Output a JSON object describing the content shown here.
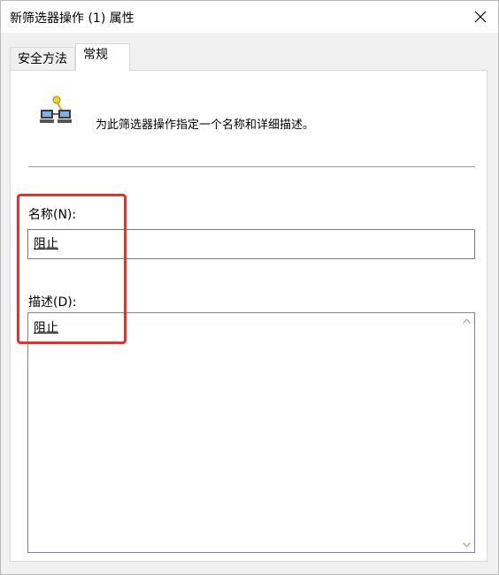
{
  "window": {
    "title": "新筛选器操作 (1) 属性"
  },
  "tabs": [
    {
      "label": "安全方法"
    },
    {
      "label": "常规"
    }
  ],
  "general": {
    "description_text": "为此筛选器操作指定一个名称和详细描述。",
    "name_label": "名称(N):",
    "name_value": "阻止",
    "desc_label": "描述(D):",
    "desc_value": "阻止"
  },
  "icons": {
    "close": "close-icon",
    "filter": "filter-action-icon",
    "scroll_up": "chevron-up-icon",
    "scroll_down": "chevron-down-icon"
  },
  "colors": {
    "highlight": "#e0342c"
  }
}
